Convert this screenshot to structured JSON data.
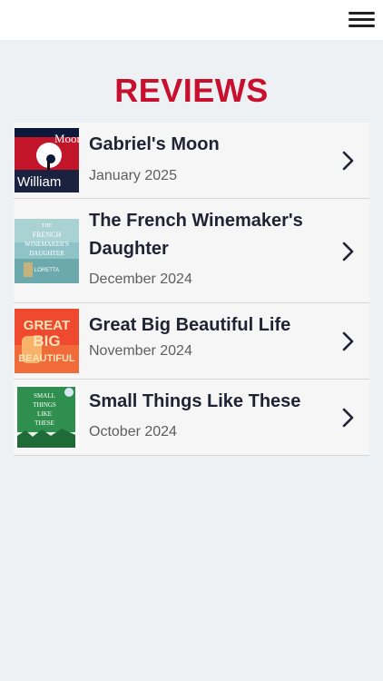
{
  "header": {
    "menu_icon": "hamburger-menu-icon"
  },
  "page": {
    "title": "REVIEWS",
    "title_color": "#c8102e"
  },
  "reviews": [
    {
      "title": "Gabriel's Moon",
      "date": "January 2025",
      "cover_text": [
        "Moon",
        "William"
      ]
    },
    {
      "title": "The French Winemaker's Daughter",
      "date": "December 2024",
      "cover_text": [
        "THE",
        "FRENCH",
        "WINEMAKER'S",
        "DAUGHTER",
        "LORETTA"
      ]
    },
    {
      "title": "Great Big Beautiful Life",
      "date": "November 2024",
      "cover_text": [
        "GREAT",
        "BIG",
        "BEAUTIFUL"
      ]
    },
    {
      "title": "Small Things Like These",
      "date": "October 2024",
      "cover_text": [
        "SMALL",
        "THINGS",
        "LIKE",
        "THESE"
      ]
    }
  ]
}
